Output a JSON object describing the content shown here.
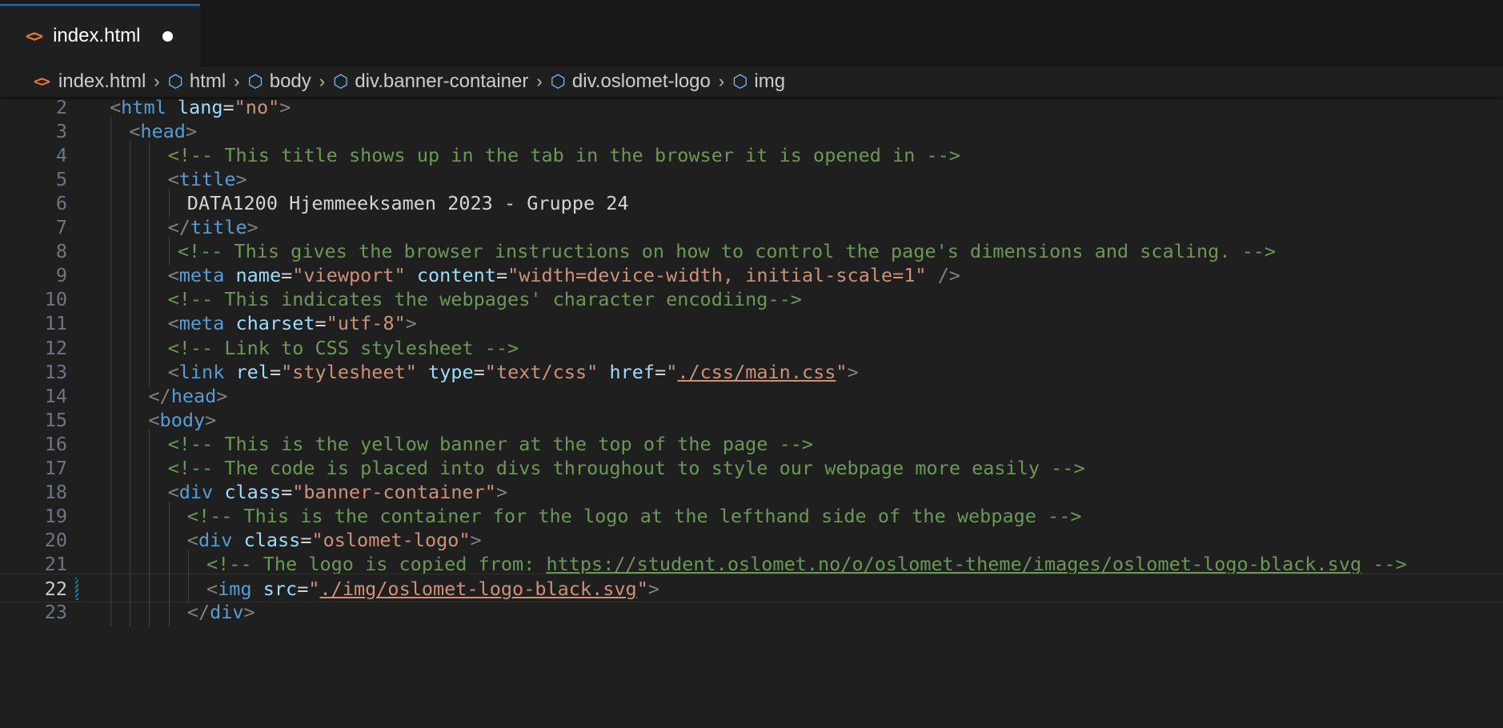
{
  "tab": {
    "label": "index.html",
    "icon": "code-file-icon",
    "modified": true
  },
  "breadcrumb": [
    {
      "label": "index.html",
      "icon": "code-file-icon"
    },
    {
      "label": "html",
      "icon": "symbol-element-icon"
    },
    {
      "label": "body",
      "icon": "symbol-element-icon"
    },
    {
      "label": "div.banner-container",
      "icon": "symbol-element-icon"
    },
    {
      "label": "div.oslomet-logo",
      "icon": "symbol-element-icon"
    },
    {
      "label": "img",
      "icon": "symbol-element-icon"
    }
  ],
  "editor": {
    "current_line": "22",
    "colors": {
      "tag": "#569cd6",
      "attr": "#9cdcfe",
      "string": "#ce9178",
      "comment": "#6a9955",
      "bracket": "#808080"
    },
    "lines": [
      {
        "num": "2",
        "tokens": [
          [
            "b",
            "<"
          ],
          [
            "tag",
            "html"
          ],
          [
            "txt",
            " "
          ],
          [
            "attr",
            "lang"
          ],
          [
            "txt",
            "="
          ],
          [
            "str",
            "\"no\""
          ],
          [
            "b",
            ">"
          ]
        ]
      },
      {
        "num": "3",
        "tokens": [
          [
            "b",
            "<"
          ],
          [
            "tag",
            "head"
          ],
          [
            "b",
            ">"
          ]
        ]
      },
      {
        "num": "4",
        "tokens": [
          [
            "com",
            "<!-- This title shows up in the tab in the browser it is opened in -->"
          ]
        ]
      },
      {
        "num": "5",
        "tokens": [
          [
            "b",
            "<"
          ],
          [
            "tag",
            "title"
          ],
          [
            "b",
            ">"
          ]
        ]
      },
      {
        "num": "6",
        "tokens": [
          [
            "txt",
            "DATA1200 Hjemmeeksamen 2023 - Gruppe 24"
          ]
        ]
      },
      {
        "num": "7",
        "tokens": [
          [
            "b",
            "</"
          ],
          [
            "tag",
            "title"
          ],
          [
            "b",
            ">"
          ]
        ]
      },
      {
        "num": "8",
        "tokens": [
          [
            "com",
            "<!-- This gives the browser instructions on how to control the page's dimensions and scaling. -->"
          ]
        ]
      },
      {
        "num": "9",
        "tokens": [
          [
            "b",
            "<"
          ],
          [
            "tag",
            "meta"
          ],
          [
            "txt",
            " "
          ],
          [
            "attr",
            "name"
          ],
          [
            "txt",
            "="
          ],
          [
            "str",
            "\"viewport\""
          ],
          [
            "txt",
            " "
          ],
          [
            "attr",
            "content"
          ],
          [
            "txt",
            "="
          ],
          [
            "str",
            "\"width=device-width, initial-scale=1\""
          ],
          [
            "txt",
            " "
          ],
          [
            "b",
            "/>"
          ]
        ]
      },
      {
        "num": "10",
        "tokens": [
          [
            "com",
            "<!-- This indicates the webpages' character encodiing-->"
          ]
        ]
      },
      {
        "num": "11",
        "tokens": [
          [
            "b",
            "<"
          ],
          [
            "tag",
            "meta"
          ],
          [
            "txt",
            " "
          ],
          [
            "attr",
            "charset"
          ],
          [
            "txt",
            "="
          ],
          [
            "str",
            "\"utf-8\""
          ],
          [
            "b",
            ">"
          ]
        ]
      },
      {
        "num": "12",
        "tokens": [
          [
            "com",
            "<!-- Link to CSS stylesheet -->"
          ]
        ]
      },
      {
        "num": "13",
        "tokens": [
          [
            "b",
            "<"
          ],
          [
            "tag",
            "link"
          ],
          [
            "txt",
            " "
          ],
          [
            "attr",
            "rel"
          ],
          [
            "txt",
            "="
          ],
          [
            "str",
            "\"stylesheet\""
          ],
          [
            "txt",
            " "
          ],
          [
            "attr",
            "type"
          ],
          [
            "txt",
            "="
          ],
          [
            "str",
            "\"text/css\""
          ],
          [
            "txt",
            " "
          ],
          [
            "attr",
            "href"
          ],
          [
            "txt",
            "="
          ],
          [
            "str",
            "\""
          ],
          [
            "strlink",
            "./css/main.css"
          ],
          [
            "str",
            "\""
          ],
          [
            "b",
            ">"
          ]
        ]
      },
      {
        "num": "14",
        "tokens": [
          [
            "b",
            "</"
          ],
          [
            "tag",
            "head"
          ],
          [
            "b",
            ">"
          ]
        ]
      },
      {
        "num": "15",
        "tokens": [
          [
            "b",
            "<"
          ],
          [
            "tag",
            "body"
          ],
          [
            "b",
            ">"
          ]
        ]
      },
      {
        "num": "16",
        "tokens": [
          [
            "com",
            "<!-- This is the yellow banner at the top of the page -->"
          ]
        ]
      },
      {
        "num": "17",
        "tokens": [
          [
            "com",
            "<!-- The code is placed into divs throughout to style our webpage more easily -->"
          ]
        ]
      },
      {
        "num": "18",
        "tokens": [
          [
            "b",
            "<"
          ],
          [
            "tag",
            "div"
          ],
          [
            "txt",
            " "
          ],
          [
            "attr",
            "class"
          ],
          [
            "txt",
            "="
          ],
          [
            "str",
            "\"banner-container\""
          ],
          [
            "b",
            ">"
          ]
        ]
      },
      {
        "num": "19",
        "tokens": [
          [
            "com",
            "<!-- This is the container for the logo at the lefthand side of the webpage -->"
          ]
        ]
      },
      {
        "num": "20",
        "tokens": [
          [
            "b",
            "<"
          ],
          [
            "tag",
            "div"
          ],
          [
            "txt",
            " "
          ],
          [
            "attr",
            "class"
          ],
          [
            "txt",
            "="
          ],
          [
            "str",
            "\"oslomet-logo\""
          ],
          [
            "b",
            ">"
          ]
        ]
      },
      {
        "num": "21",
        "tokens": [
          [
            "com",
            "<!-- The logo is copied from: "
          ],
          [
            "comlink",
            "https://student.oslomet.no/o/oslomet-theme/images/oslomet-logo-black.svg"
          ],
          [
            "com",
            " -->"
          ]
        ]
      },
      {
        "num": "22",
        "tokens": [
          [
            "b",
            "<"
          ],
          [
            "tag",
            "img"
          ],
          [
            "txt",
            " "
          ],
          [
            "attr",
            "src"
          ],
          [
            "txt",
            "="
          ],
          [
            "str",
            "\""
          ],
          [
            "strlink",
            "./img/oslomet-logo-black.svg"
          ],
          [
            "str",
            "\""
          ],
          [
            "b",
            ">"
          ]
        ]
      },
      {
        "num": "23",
        "tokens": [
          [
            "b",
            "</"
          ],
          [
            "tag",
            "div"
          ],
          [
            "b",
            ">"
          ]
        ]
      }
    ]
  }
}
